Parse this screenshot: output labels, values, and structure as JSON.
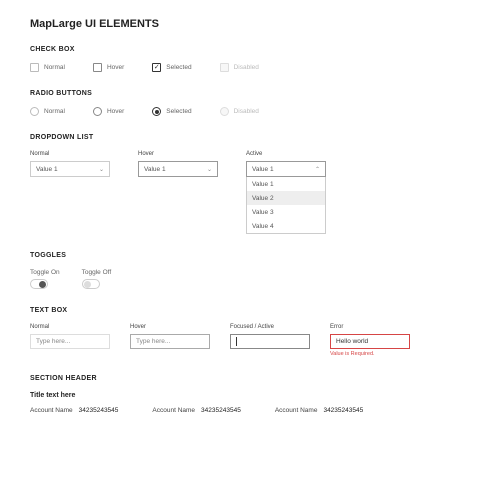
{
  "page_title": "MapLarge UI ELEMENTS",
  "checkbox": {
    "section": "CHECK BOX",
    "normal": "Normal",
    "hover": "Hover",
    "selected": "Selected",
    "disabled": "Disabled"
  },
  "radio": {
    "section": "RADIO BUTTONS",
    "normal": "Normal",
    "hover": "Hover",
    "selected": "Selected",
    "disabled": "Disabled"
  },
  "dropdown": {
    "section": "DROPDOWN LIST",
    "normal_label": "Normal",
    "hover_label": "Hover",
    "active_label": "Active",
    "value": "Value 1",
    "items": {
      "0": "Value 1",
      "1": "Value 2",
      "2": "Value 3",
      "3": "Value 4"
    }
  },
  "toggles": {
    "section": "TOGGLES",
    "on_label": "Toggle On",
    "off_label": "Toggle Off"
  },
  "textbox": {
    "section": "TEXT BOX",
    "normal_label": "Normal",
    "hover_label": "Hover",
    "active_label": "Focused / Active",
    "error_label": "Error",
    "placeholder": "Type here...",
    "error_value": "Hello world",
    "error_msg": "Value is Required."
  },
  "section_header": {
    "section": "SECTION HEADER",
    "title": "Title text here",
    "acct_label": "Account Name",
    "acct_value": "34235243545"
  }
}
